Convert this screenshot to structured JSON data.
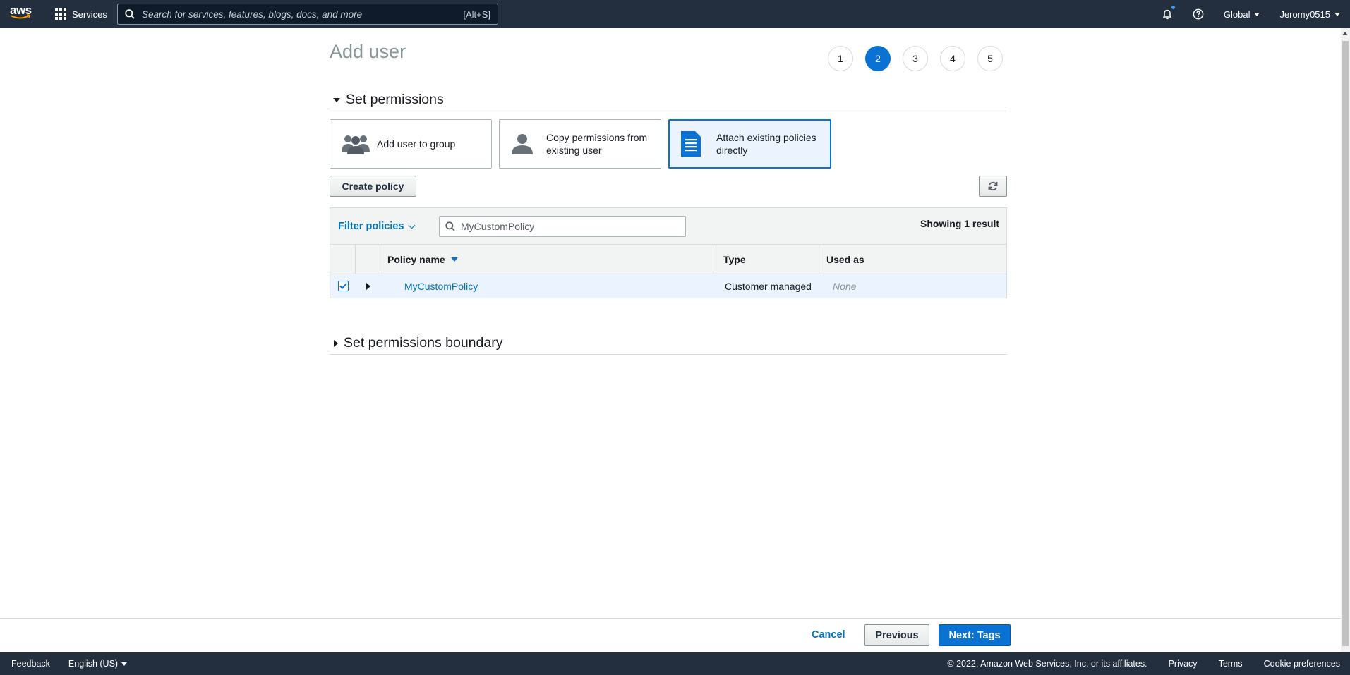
{
  "topnav": {
    "logo_text": "aws",
    "services_label": "Services",
    "search_placeholder": "Search for services, features, blogs, docs, and more",
    "search_shortcut": "[Alt+S]",
    "region": "Global",
    "account": "Jeromy0515"
  },
  "page": {
    "title": "Add user",
    "steps": [
      "1",
      "2",
      "3",
      "4",
      "5"
    ],
    "active_step": 2
  },
  "permissions": {
    "section_title": "Set permissions",
    "options": [
      {
        "label": "Add user to group",
        "icon": "group-icon",
        "selected": false
      },
      {
        "label": "Copy permissions from existing user",
        "icon": "user-icon",
        "selected": false
      },
      {
        "label": "Attach existing policies directly",
        "icon": "document-icon",
        "selected": true
      }
    ],
    "create_policy_label": "Create policy",
    "refresh_icon": "refresh-icon"
  },
  "table": {
    "filter_label": "Filter policies",
    "filter_value": "MyCustomPolicy",
    "showing": "Showing 1 result",
    "columns": [
      "Policy name",
      "Type",
      "Used as"
    ],
    "rows": [
      {
        "name": "MyCustomPolicy",
        "type": "Customer managed",
        "used_as": "None",
        "checked": true
      }
    ]
  },
  "boundary": {
    "section_title": "Set permissions boundary"
  },
  "actions": {
    "cancel": "Cancel",
    "previous": "Previous",
    "next": "Next: Tags"
  },
  "footer": {
    "feedback": "Feedback",
    "language": "English (US)",
    "copyright": "© 2022, Amazon Web Services, Inc. or its affiliates.",
    "privacy": "Privacy",
    "terms": "Terms",
    "cookies": "Cookie preferences"
  },
  "colors": {
    "nav_bg": "#232f3e",
    "accent": "#0972d3",
    "link": "#0073bb",
    "selected_bg": "#eaf3fe"
  }
}
